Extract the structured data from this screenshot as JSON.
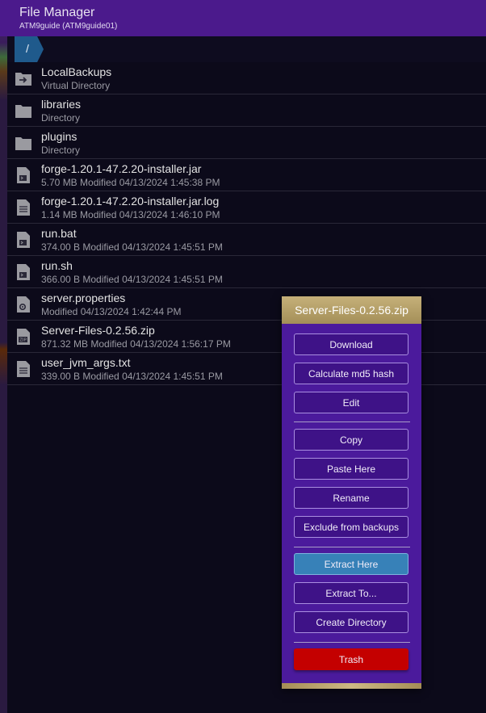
{
  "window": {
    "title": "File Manager",
    "subtitle": "ATM9guide (ATM9guide01)"
  },
  "breadcrumb": {
    "root": "/"
  },
  "files": [
    {
      "name": "LocalBackups",
      "meta": "Virtual Directory",
      "icon": "virtual-folder-icon"
    },
    {
      "name": "libraries",
      "meta": "Directory",
      "icon": "folder-icon"
    },
    {
      "name": "plugins",
      "meta": "Directory",
      "icon": "folder-icon"
    },
    {
      "name": "forge-1.20.1-47.2.20-installer.jar",
      "meta": "5.70 MB Modified 04/13/2024 1:45:38 PM",
      "icon": "executable-file-icon"
    },
    {
      "name": "forge-1.20.1-47.2.20-installer.jar.log",
      "meta": "1.14 MB Modified 04/13/2024 1:46:10 PM",
      "icon": "text-file-icon"
    },
    {
      "name": "run.bat",
      "meta": "374.00 B Modified 04/13/2024 1:45:51 PM",
      "icon": "executable-file-icon"
    },
    {
      "name": "run.sh",
      "meta": "366.00 B Modified 04/13/2024 1:45:51 PM",
      "icon": "executable-file-icon"
    },
    {
      "name": "server.properties",
      "meta": "Modified 04/13/2024 1:42:44 PM",
      "icon": "settings-file-icon"
    },
    {
      "name": "Server-Files-0.2.56.zip",
      "meta": "871.32 MB Modified 04/13/2024 1:56:17 PM",
      "icon": "zip-file-icon"
    },
    {
      "name": "user_jvm_args.txt",
      "meta": "339.00 B Modified 04/13/2024 1:45:51 PM",
      "icon": "text-file-icon"
    }
  ],
  "context_menu": {
    "title": "Server-Files-0.2.56.zip",
    "download": "Download",
    "md5": "Calculate md5 hash",
    "edit": "Edit",
    "copy": "Copy",
    "paste": "Paste Here",
    "rename": "Rename",
    "exclude": "Exclude from backups",
    "extract_here": "Extract Here",
    "extract_to": "Extract To...",
    "create_dir": "Create Directory",
    "trash": "Trash"
  },
  "colors": {
    "header": "#4b1a8c",
    "menu_bg": "#4b1a9c",
    "menu_gold": "#c6b07a",
    "accent_blue": "#3781b8",
    "danger": "#c40000"
  }
}
